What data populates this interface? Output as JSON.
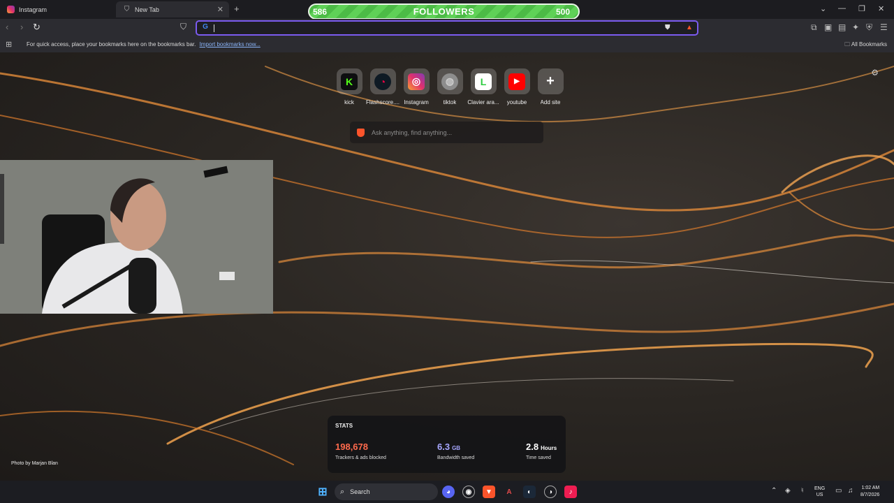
{
  "tabs": [
    {
      "label": "Instagram",
      "favicon": "instagram-icon"
    },
    {
      "label": "New Tab",
      "favicon": "brave-shield-icon",
      "active": true
    }
  ],
  "followers_overlay": {
    "current": "586",
    "label": "FOLLOWERS",
    "goal": "500"
  },
  "bookmarks_bar": {
    "message": "For quick access, place your bookmarks here on the bookmarks bar.",
    "import_link": "Import bookmarks now...",
    "all_bookmarks": "All Bookmarks"
  },
  "top_sites": [
    {
      "label": "kick",
      "icon": "kick-icon",
      "color": "#53fc18"
    },
    {
      "label": "Flashscore....",
      "icon": "flashscore-icon",
      "color": "#ff0046"
    },
    {
      "label": "Instagram",
      "icon": "instagram-icon",
      "color": "#e1306c"
    },
    {
      "label": "tiktok",
      "icon": "globe-icon",
      "color": "#888888"
    },
    {
      "label": "Clavier ara...",
      "icon": "clavier-icon",
      "color": "#2ecc40"
    },
    {
      "label": "youtube",
      "icon": "youtube-icon",
      "color": "#ff0000"
    },
    {
      "label": "Add site",
      "icon": "plus-icon",
      "color": "#ffffff"
    }
  ],
  "search": {
    "placeholder": "Ask anything, find anything..."
  },
  "stats": {
    "title": "STATS",
    "items": [
      {
        "value": "198,678",
        "unit": "",
        "desc": "Trackers & ads blocked",
        "color": "#ff6a4d"
      },
      {
        "value": "6.3",
        "unit": "GB",
        "desc": "Bandwidth saved",
        "color": "#a7a7ff"
      },
      {
        "value": "2.8",
        "unit": "Hours",
        "desc": "Time saved",
        "color": "#ffffff"
      }
    ]
  },
  "photo_credit": "Photo by Marjan Blan",
  "taskbar": {
    "search_label": "Search",
    "lang_top": "ENG",
    "lang_bottom": "US",
    "time": "1:02 AM",
    "date": "8/7/2026"
  }
}
